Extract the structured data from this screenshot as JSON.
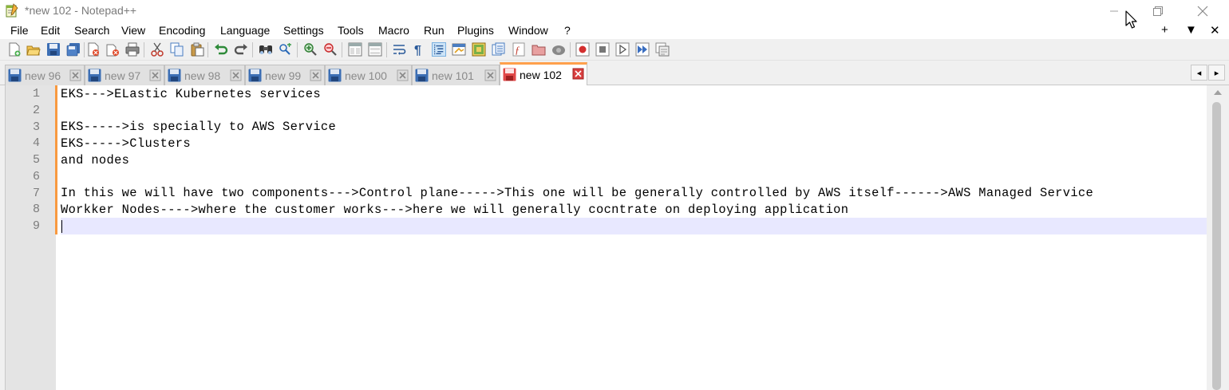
{
  "window": {
    "title": "*new 102 - Notepad++",
    "icon": "notepad-plus-plus-icon",
    "controls": [
      "minimize-icon",
      "restore-icon",
      "close-icon"
    ]
  },
  "menu": {
    "items": [
      "File",
      "Edit",
      "Search",
      "View",
      "Encoding",
      "Language",
      "Settings",
      "Tools",
      "Macro",
      "Run",
      "Plugins",
      "Window",
      "?"
    ],
    "right_controls": [
      "+",
      "▼",
      "✕"
    ]
  },
  "toolbar": {
    "icons": [
      "new-file-icon",
      "open-file-icon",
      "save-icon",
      "save-all-icon",
      "close-icon",
      "close-all-icon",
      "print-icon",
      "cut-icon",
      "copy-icon",
      "paste-icon",
      "undo-icon",
      "redo-icon",
      "find-icon",
      "replace-icon",
      "zoom-in-icon",
      "zoom-out-icon",
      "sync-vertical-icon",
      "sync-horizontal-icon",
      "word-wrap-icon",
      "show-all-characters-icon",
      "indent-guide-icon",
      "udl-icon",
      "document-map-icon",
      "document-list-icon",
      "function-list-icon",
      "folder-workspace-icon",
      "monitoring-icon",
      "record-macro-icon",
      "stop-macro-icon",
      "play-macro-icon",
      "run-macro-multiple-icon",
      "save-macro-icon"
    ]
  },
  "tabs": [
    {
      "label": "new 96",
      "active": false
    },
    {
      "label": "new 97",
      "active": false
    },
    {
      "label": "new 98",
      "active": false
    },
    {
      "label": "new 99",
      "active": false
    },
    {
      "label": "new 100",
      "active": false
    },
    {
      "label": "new 101",
      "active": false
    },
    {
      "label": "new 102",
      "active": true
    }
  ],
  "editor": {
    "line_numbers": [
      "1",
      "2",
      "3",
      "4",
      "5",
      "6",
      "7",
      "8",
      "9"
    ],
    "lines": [
      "EKS--->ELastic Kubernetes services",
      "",
      "EKS----->is specially to AWS Service",
      "EKS----->Clusters",
      "and nodes",
      "",
      "In this we will have two components--->Control plane----->This one will be generally controlled by AWS itself------>AWS Managed Service",
      "Workker Nodes---->where the customer works--->here we will generally cocntrate on deploying application",
      ""
    ],
    "current_line": 9
  },
  "colors": {
    "active_tab_accent": "#ffa04c",
    "current_line_highlight": "#e8e8ff",
    "change_history": "#f89a40",
    "gutter": "#e4e4e4"
  }
}
